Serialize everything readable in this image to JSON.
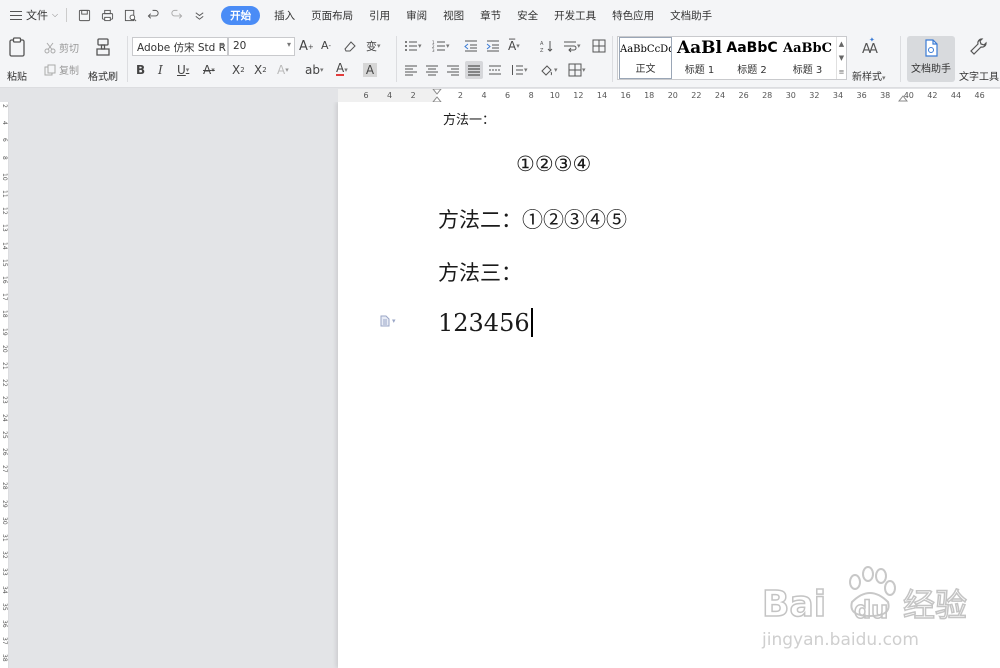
{
  "menubar": {
    "file_label": "文件",
    "tabs": [
      "开始",
      "插入",
      "页面布局",
      "引用",
      "审阅",
      "视图",
      "章节",
      "安全",
      "开发工具",
      "特色应用",
      "文档助手"
    ],
    "active_tab": "开始"
  },
  "ribbon": {
    "paste_label": "粘贴",
    "cut_label": "剪切",
    "copy_label": "复制",
    "format_painter_label": "格式刷",
    "font_name": "Adobe 仿宋 Std R",
    "font_size": "20",
    "styles": [
      {
        "sample": "AaBbCcDd",
        "name": "正文"
      },
      {
        "sample": "AaBl",
        "name": "标题 1"
      },
      {
        "sample": "AaBbC",
        "name": "标题 2"
      },
      {
        "sample": "AaBbC",
        "name": "标题 3"
      }
    ],
    "new_style_label": "新样式",
    "doc_assistant_label": "文档助手",
    "text_tools_label": "文字工具"
  },
  "ruler": {
    "h_numbers": [
      "6",
      "4",
      "2",
      "",
      "2",
      "4",
      "6",
      "8",
      "10",
      "12",
      "14",
      "16",
      "18",
      "20",
      "22",
      "24",
      "26",
      "28",
      "30",
      "32",
      "34",
      "36",
      "38",
      "40",
      "42",
      "44",
      "46"
    ],
    "v_numbers": [
      "2",
      "4",
      "6",
      "8",
      "10",
      "11",
      "12",
      "13",
      "14",
      "15",
      "16",
      "17",
      "18",
      "19",
      "20",
      "21",
      "22",
      "23",
      "24",
      "25",
      "26",
      "27",
      "28",
      "29",
      "30",
      "31",
      "32",
      "33",
      "34",
      "35",
      "36",
      "37",
      "38"
    ]
  },
  "document": {
    "line1": "方法一：",
    "line2": "①②③④",
    "line3": "方法二：①②③④⑤",
    "line4": "方法三：",
    "line5": "123456"
  },
  "colors": {
    "accent": "#4a8cf6",
    "ribbon_bg": "#f4f5f7",
    "canvas_bg": "#e3e4e7",
    "page_bg": "#ffffff"
  },
  "watermark": {
    "brand": "Bai du 经验",
    "url": "jingyan.baidu.com"
  }
}
